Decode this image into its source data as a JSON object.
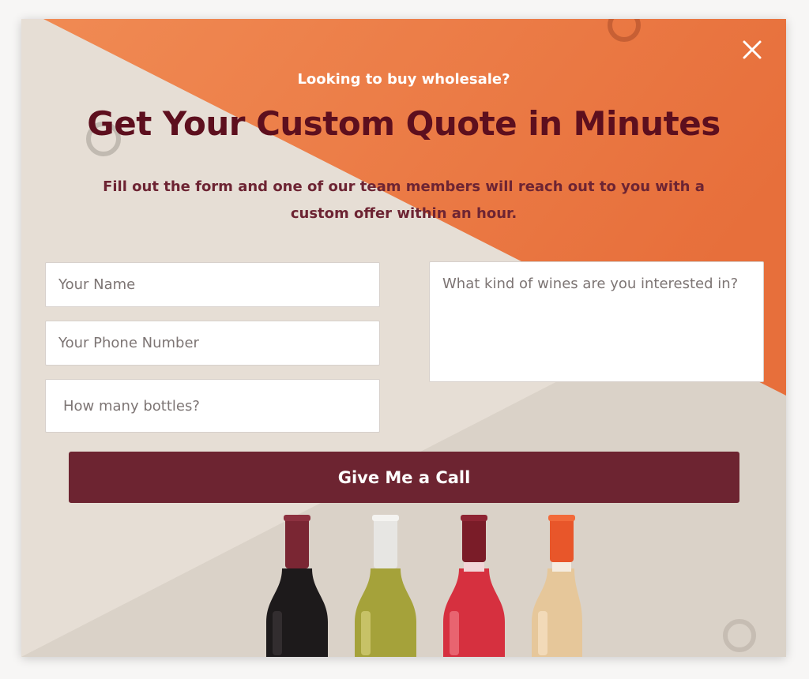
{
  "popup": {
    "eyebrow": "Looking to buy wholesale?",
    "headline": "Get Your Custom Quote in Minutes",
    "subtext": "Fill out the form and one of our team members will reach out to you with a custom offer within an hour.",
    "close_icon": "close-icon"
  },
  "form": {
    "name_placeholder": "Your Name",
    "phone_placeholder": "Your Phone Number",
    "bottles_placeholder": "How many bottles?",
    "wines_placeholder": "What kind of wines are you interested in?",
    "submit_label": "Give Me a Call"
  },
  "theme": {
    "accent_orange": "#ea7a43",
    "headline_color": "#5d0f1e",
    "button_color": "#6d2431",
    "background_beige": "#e6ded5"
  }
}
